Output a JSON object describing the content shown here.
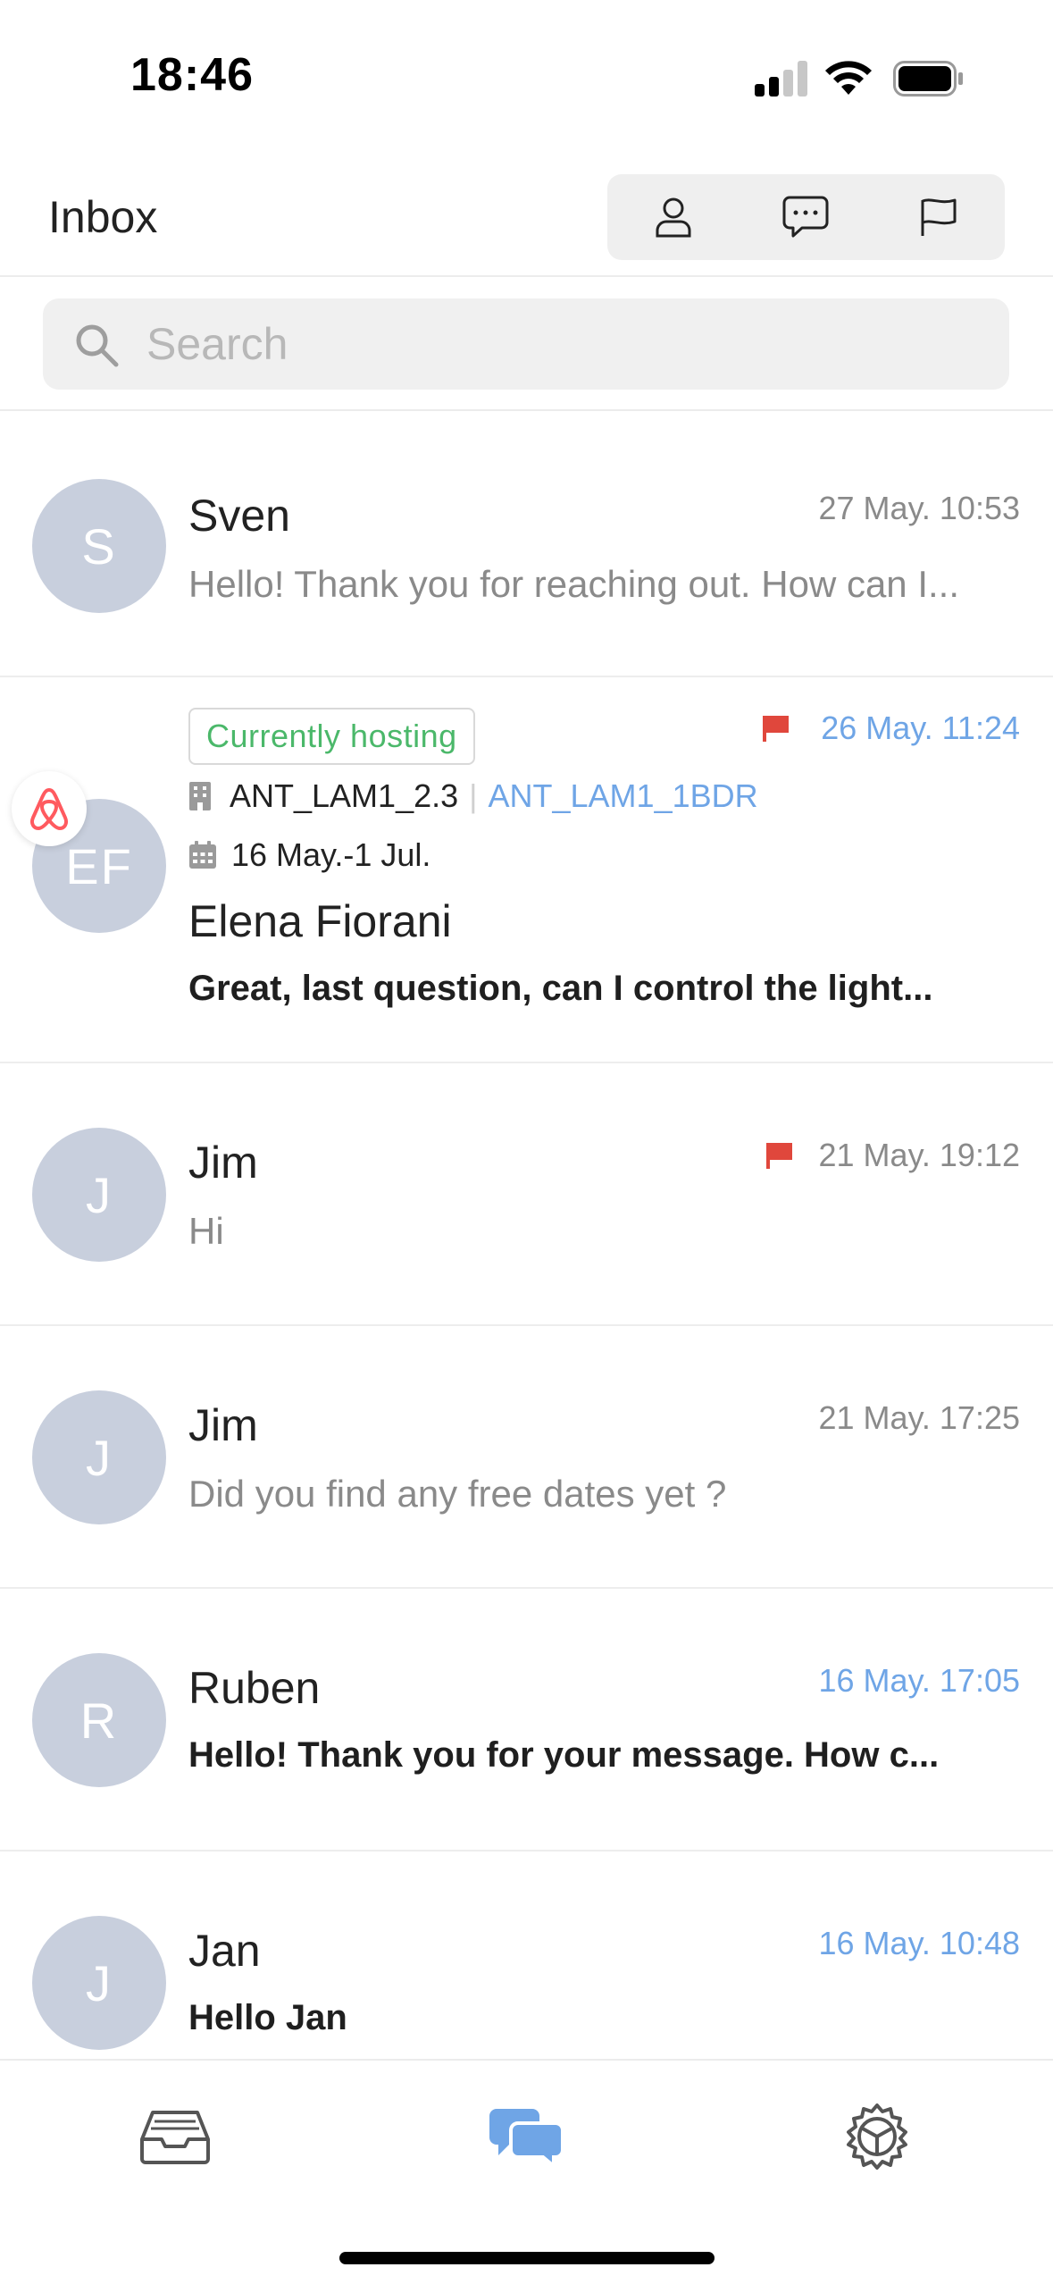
{
  "status_bar": {
    "time": "18:46"
  },
  "header": {
    "title": "Inbox"
  },
  "search": {
    "placeholder": "Search"
  },
  "conversations": [
    {
      "initials": "S",
      "name": "Sven",
      "date": "27 May. 10:53",
      "preview": "Hello! Thank you for reaching out. How can I...",
      "unread": false,
      "flagged": false
    },
    {
      "initials": "EF",
      "name": "Elena Fiorani",
      "date": "26 May. 11:24",
      "preview": "Great, last question, can I control the light...",
      "unread": true,
      "flagged": true,
      "status": "Currently hosting",
      "property": "ANT_LAM1_2.3",
      "listing": "ANT_LAM1_1BDR",
      "dates": "16 May.-1 Jul.",
      "source_icon": "airbnb-icon"
    },
    {
      "initials": "J",
      "name": "Jim",
      "date": "21 May. 19:12",
      "preview": "Hi",
      "unread": false,
      "flagged": true
    },
    {
      "initials": "J",
      "name": "Jim",
      "date": "21 May. 17:25",
      "preview": "Did you find any free dates yet ?",
      "unread": false,
      "flagged": false
    },
    {
      "initials": "R",
      "name": "Ruben",
      "date": "16 May. 17:05",
      "preview": "Hello! Thank you for your message. How c...",
      "unread": true,
      "flagged": false
    },
    {
      "initials": "J",
      "name": "Jan",
      "date": "16 May. 10:48",
      "preview": "Hello Jan",
      "unread": true,
      "flagged": false
    }
  ],
  "tabs": [
    {
      "icon": "inbox-tray-icon",
      "active": false
    },
    {
      "icon": "chat-bubbles-icon",
      "active": true
    },
    {
      "icon": "settings-wheel-icon",
      "active": false
    }
  ],
  "colors": {
    "accent": "#6fa5e6",
    "flag": "#e0473c",
    "hosting": "#4bb86a",
    "avatar": "#c8cfdd"
  }
}
